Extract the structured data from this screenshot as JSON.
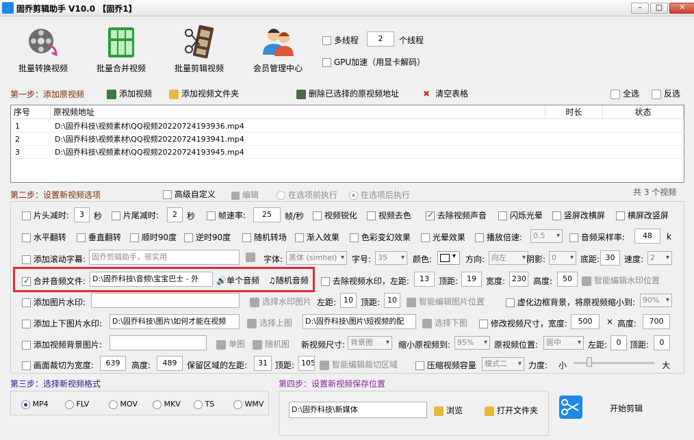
{
  "window": {
    "title": "固乔剪辑助手 V10.0 【固乔1】",
    "min": "▭",
    "max": "□",
    "close": "✕"
  },
  "toolbar": [
    {
      "label": "批量转换视频",
      "icon": "film-reel-icon"
    },
    {
      "label": "批量合并视频",
      "icon": "merge-blocks-icon"
    },
    {
      "label": "批量剪辑视频",
      "icon": "film-scissors-icon"
    },
    {
      "label": "会员管理中心",
      "icon": "users-icon"
    }
  ],
  "threads": {
    "label": "多线程",
    "value": "2",
    "unit": "个线程"
  },
  "gpu": {
    "label": "GPU加速（用显卡解码）"
  },
  "step1": {
    "title": "第一步：添加原视频",
    "add_video": "添加视频",
    "add_folder": "添加视频文件夹",
    "delete_selected": "删除已选择的原视频地址",
    "clear": "清空表格",
    "select_all": "全选",
    "invert": "反选"
  },
  "table": {
    "columns": [
      "序号",
      "原视频地址",
      "时长",
      "状态"
    ],
    "rows": [
      [
        "1",
        "D:\\固乔科技\\视频素材\\QQ视频20220724193936.mp4",
        "",
        ""
      ],
      [
        "2",
        "D:\\固乔科技\\视频素材\\QQ视频20220724193941.mp4",
        "",
        ""
      ],
      [
        "3",
        "D:\\固乔科技\\视频素材\\QQ视频20220724193945.mp4",
        "",
        ""
      ]
    ]
  },
  "step2": {
    "title": "第二步：设置新视频选项",
    "advanced": "高级自定义",
    "edit": "编辑",
    "before": "在选项前执行",
    "after": "在选项后执行",
    "count": "共 3 个视频"
  },
  "row1": {
    "head_cut": "片头减时:",
    "head_val": "3",
    "sec1": "秒",
    "tail_cut": "片尾减时:",
    "tail_val": "2",
    "sec2": "秒",
    "fps": "帧速率:",
    "fps_val": "25",
    "fps_unit": "帧/秒",
    "sharpen": "视频锐化",
    "decolor": "视频去色",
    "remove_audio": "去除视频声音",
    "flash": "闪烁光晕",
    "v2h": "竖屏改横屏",
    "h2v": "横屏改竖屏"
  },
  "row2": {
    "hflip": "水平翻转",
    "vflip": "垂直翻转",
    "cw90": "顺时90度",
    "ccw90": "逆时90度",
    "random_transition": "随机转场",
    "fade_in": "渐入效果",
    "color_fantasy": "色彩变幻效果",
    "halo": "光晕效果",
    "speed": "播放倍速:",
    "speed_val": "0.5",
    "sample_rate": "音频采样率:",
    "sample_val": "48",
    "k": "k"
  },
  "row3": {
    "scroll_text": "添加滚动字幕:",
    "scroll_val": "固乔剪辑助手，很实用",
    "font": "字体:",
    "font_val": "黑体 (simhei)",
    "size": "字号:",
    "size_val": "35",
    "color": "颜色:",
    "direction": "方向:",
    "direction_val": "向左",
    "shadow": "阴影:",
    "shadow_val": "0",
    "bottom": "底距:",
    "bottom_val": "30",
    "speed": "速度:",
    "speed_val": "2"
  },
  "row4": {
    "merge_audio": "合并音频文件:",
    "audio_val": "D:\\固乔科技\\音频\\宝宝巴士 - 外",
    "single_audio": "单个音频",
    "random_audio": "随机音频",
    "remove_watermark": "去除视频水印，左距:",
    "left_val": "13",
    "top": "顶距:",
    "top_val": "19",
    "width": "宽度:",
    "width_val": "230",
    "height": "高度:",
    "height_val": "50",
    "smart_watermark": "智能编辑水印位置"
  },
  "row5": {
    "image_watermark": "添加图片水印:",
    "image_val": "",
    "choose_image": "选择水印图片",
    "left": "左距:",
    "left_val": "10",
    "top": "顶距:",
    "top_val": "10",
    "smart_image": "智能编辑图片位置",
    "blur_bg": "虚化边框背景，将原视频缩小到:",
    "blur_val": "90%"
  },
  "row6": {
    "top_bottom_wm": "添加上下图片水印:",
    "top_img": "D:\\固乔科技\\图片\\如何才能在视频",
    "choose_top": "选择上图",
    "bottom_img": "D:\\固乔科技\\图片\\短视频的配",
    "choose_bottom": "选择下图",
    "resize": "修改视频尺寸，宽度:",
    "w_val": "500",
    "x": "×",
    "h_label": "高度:",
    "h_val": "700"
  },
  "row7": {
    "bg_image": "添加视频背景图片:",
    "bg_val": "",
    "single": "单图",
    "random": "随机图",
    "new_size": "新视频尺寸:",
    "new_size_val": "背景图",
    "shrink": "缩小原视频到:",
    "shrink_val": "95%",
    "position": "原视频位置:",
    "position_val": "居中",
    "left": "左距:",
    "left_val": "0",
    "top": "顶距:",
    "top_val": "0"
  },
  "row8": {
    "crop": "画面裁切为宽度:",
    "crop_w": "639",
    "height": "高度:",
    "crop_h": "489",
    "keep_left": "保留区域的左距:",
    "keep_left_val": "31",
    "top": "顶距:",
    "top_val": "105",
    "smart_crop": "智能编辑裁切区域",
    "compress": "压缩视频容量",
    "mode_val": "模式二",
    "strength": "力度:",
    "small": "小",
    "big": "大",
    "slider_pct": 0.17
  },
  "step3": {
    "title": "第三步：选择新视频格式",
    "formats": [
      "MP4",
      "FLV",
      "MOV",
      "MKV",
      "TS",
      "WMV"
    ]
  },
  "step4": {
    "title": "第四步：设置新视频保存位置",
    "path": "D:\\固乔科技\\新媒体",
    "browse": "浏览",
    "open_folder": "打开文件夹",
    "start": "开始剪辑"
  },
  "colors": {
    "highlight": "#e5292b",
    "step_brown": "#7a2a00",
    "step_blue": "#1a1a8c",
    "step_purple": "#8a1ea0"
  }
}
